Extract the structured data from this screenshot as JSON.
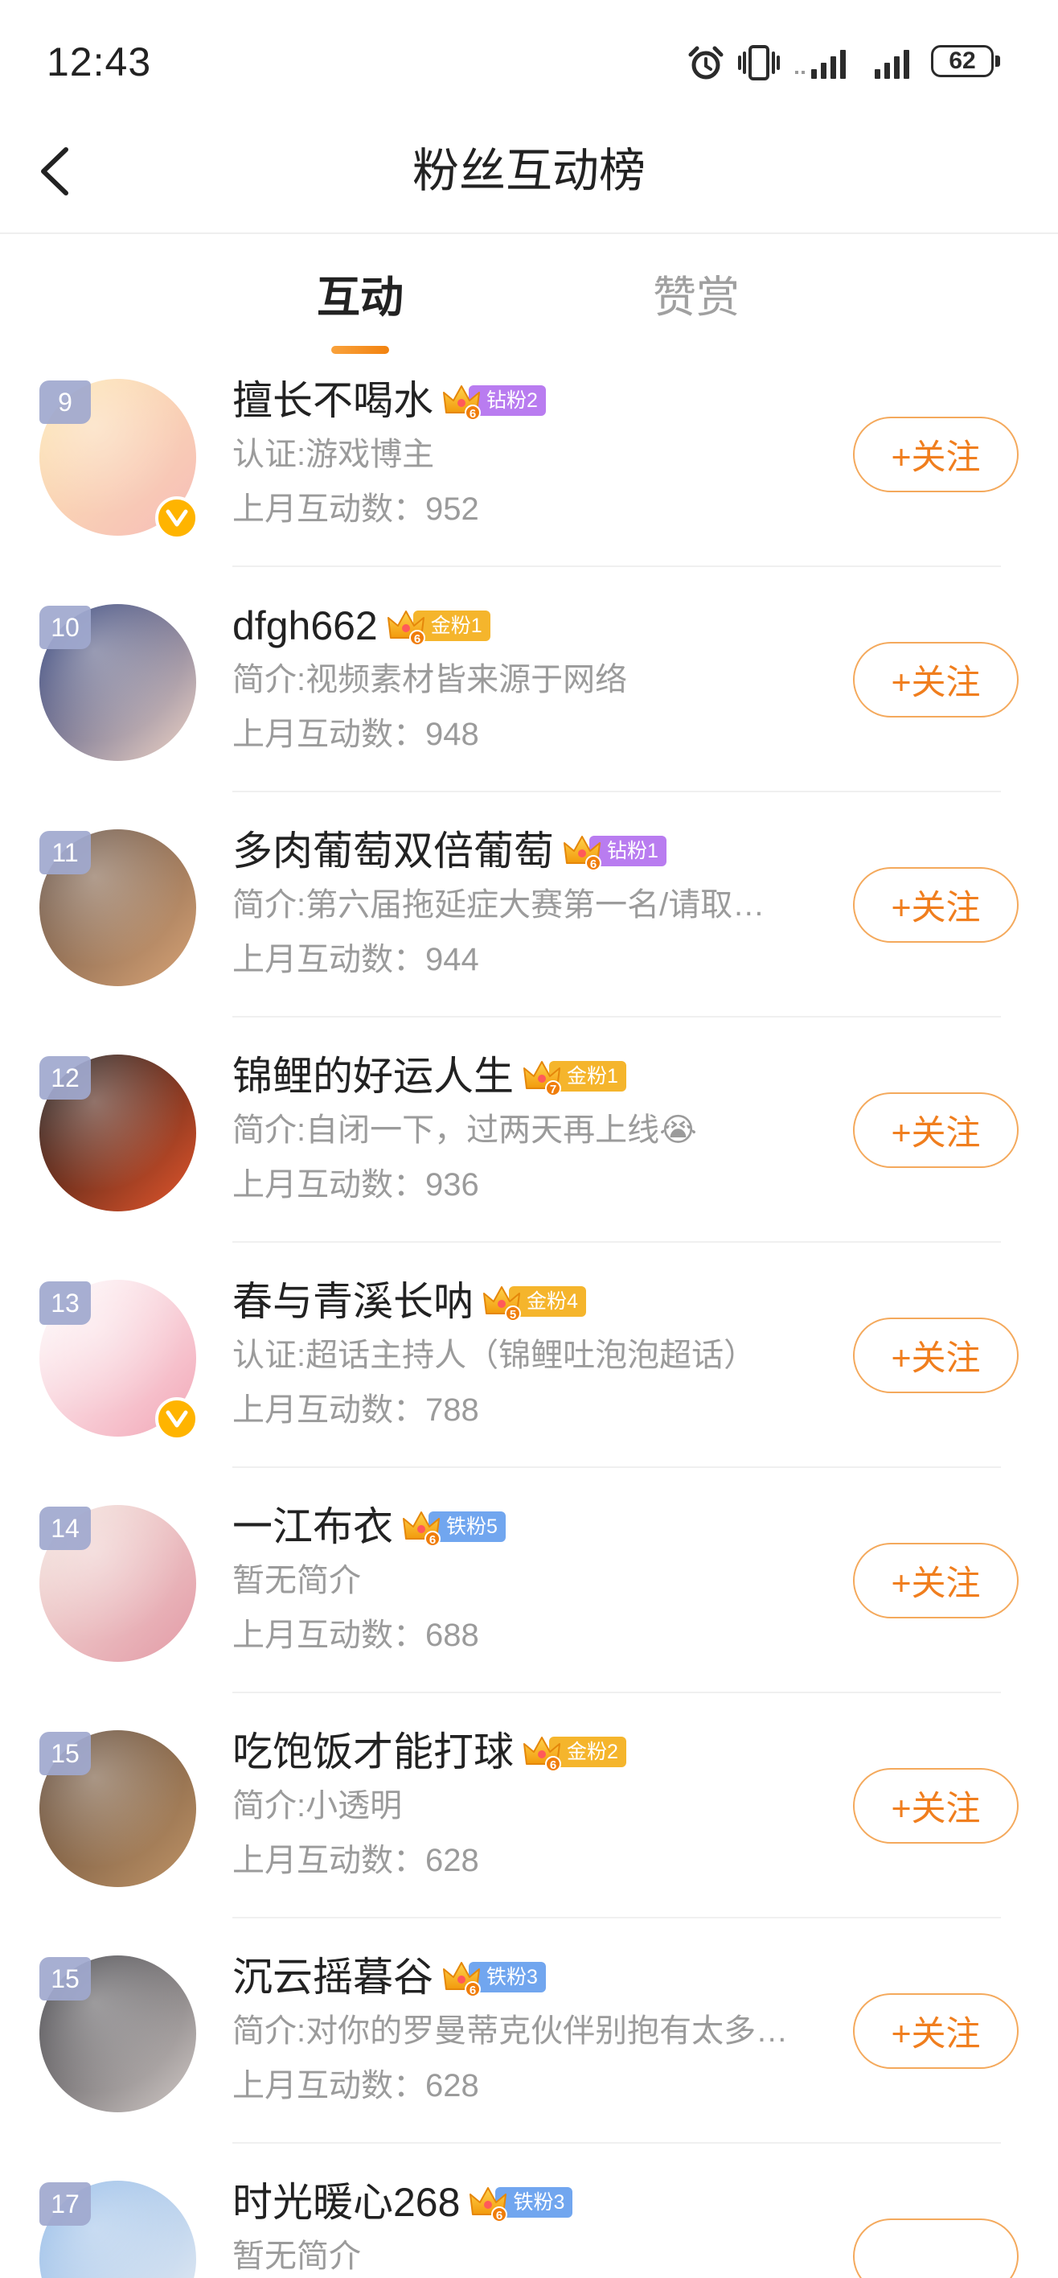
{
  "status_bar": {
    "time": "12:43",
    "battery": "62",
    "icons": [
      "alarm-icon",
      "vibrate-icon",
      "signal-icon",
      "signal-icon",
      "battery-icon"
    ]
  },
  "header": {
    "title": "粉丝互动榜",
    "back_icon": "chevron-left-icon"
  },
  "tabs": [
    {
      "label": "互动",
      "active": true
    },
    {
      "label": "赞赏",
      "active": false
    }
  ],
  "colors": {
    "accent": "#f2820f",
    "follow_text": "#f07e1e",
    "diamond_badge": "#b97cf0",
    "gold_badge": "#f5b52c",
    "iron_badge": "#71a6ef"
  },
  "list": [
    {
      "rank": "9",
      "name": "擅长不喝水",
      "badge": {
        "level": "6",
        "label": "钻粉2",
        "color": "#b97cf0"
      },
      "bio": "认证:游戏博主",
      "verified": true,
      "count_label": "上月互动数：",
      "count": "952",
      "follow_label": "+关注",
      "avatar_colors": [
        "#fde7b2",
        "#f6bcb8"
      ]
    },
    {
      "rank": "10",
      "name": "dfgh662",
      "badge": {
        "level": "6",
        "label": "金粉1",
        "color": "#f5b52c"
      },
      "bio": "简介:视频素材皆来源于网络",
      "verified": false,
      "count_label": "上月互动数：",
      "count": "948",
      "follow_label": "+关注",
      "avatar_colors": [
        "#1c2f6e",
        "#f1d5c6"
      ]
    },
    {
      "rank": "11",
      "name": "多肉葡萄双倍葡萄",
      "badge": {
        "level": "6",
        "label": "钻粉1",
        "color": "#b97cf0"
      },
      "bio": "简介:第六届拖延症大赛第一名/请取…",
      "verified": false,
      "count_label": "上月互动数：",
      "count": "944",
      "follow_label": "+关注",
      "avatar_colors": [
        "#5e4a3e",
        "#d9a476"
      ]
    },
    {
      "rank": "12",
      "name": "锦鲤的好运人生",
      "badge": {
        "level": "7",
        "label": "金粉1",
        "color": "#f5b52c"
      },
      "bio": "简介:自闭一下，过两天再上线😭",
      "verified": false,
      "count_label": "上月互动数：",
      "count": "936",
      "follow_label": "+关注",
      "avatar_colors": [
        "#111111",
        "#e5562c"
      ]
    },
    {
      "rank": "13",
      "name": "春与青溪长呐",
      "badge": {
        "level": "5",
        "label": "金粉4",
        "color": "#f5b52c"
      },
      "bio": "认证:超话主持人（锦鲤吐泡泡超话）",
      "verified": true,
      "count_label": "上月互动数：",
      "count": "788",
      "follow_label": "+关注",
      "avatar_colors": [
        "#ffffff",
        "#f2a6b6"
      ]
    },
    {
      "rank": "14",
      "name": "一江布衣",
      "badge": {
        "level": "6",
        "label": "铁粉5",
        "color": "#71a6ef"
      },
      "bio": "暂无简介",
      "verified": false,
      "count_label": "上月互动数：",
      "count": "688",
      "follow_label": "+关注",
      "avatar_colors": [
        "#f4e6df",
        "#e39aa6"
      ]
    },
    {
      "rank": "15",
      "name": "吃饱饭才能打球",
      "badge": {
        "level": "6",
        "label": "金粉2",
        "color": "#f5b52c"
      },
      "bio": "简介:小透明",
      "verified": false,
      "count_label": "上月互动数：",
      "count": "628",
      "follow_label": "+关注",
      "avatar_colors": [
        "#5a4332",
        "#c09467"
      ]
    },
    {
      "rank": "15",
      "name": "沉云摇暮谷",
      "badge": {
        "level": "6",
        "label": "铁粉3",
        "color": "#71a6ef"
      },
      "bio": "简介:对你的罗曼蒂克伙伴别抱有太多…",
      "verified": false,
      "count_label": "上月互动数：",
      "count": "628",
      "follow_label": "+关注",
      "avatar_colors": [
        "#34343a",
        "#d3cbc8"
      ]
    },
    {
      "rank": "17",
      "name": "时光暖心268",
      "badge": {
        "level": "6",
        "label": "铁粉3",
        "color": "#71a6ef"
      },
      "bio": "暂无简介",
      "verified": false,
      "count_label": "",
      "count": "",
      "follow_label": "",
      "avatar_colors": [
        "#8cb6e6",
        "#e9eef4"
      ]
    }
  ]
}
